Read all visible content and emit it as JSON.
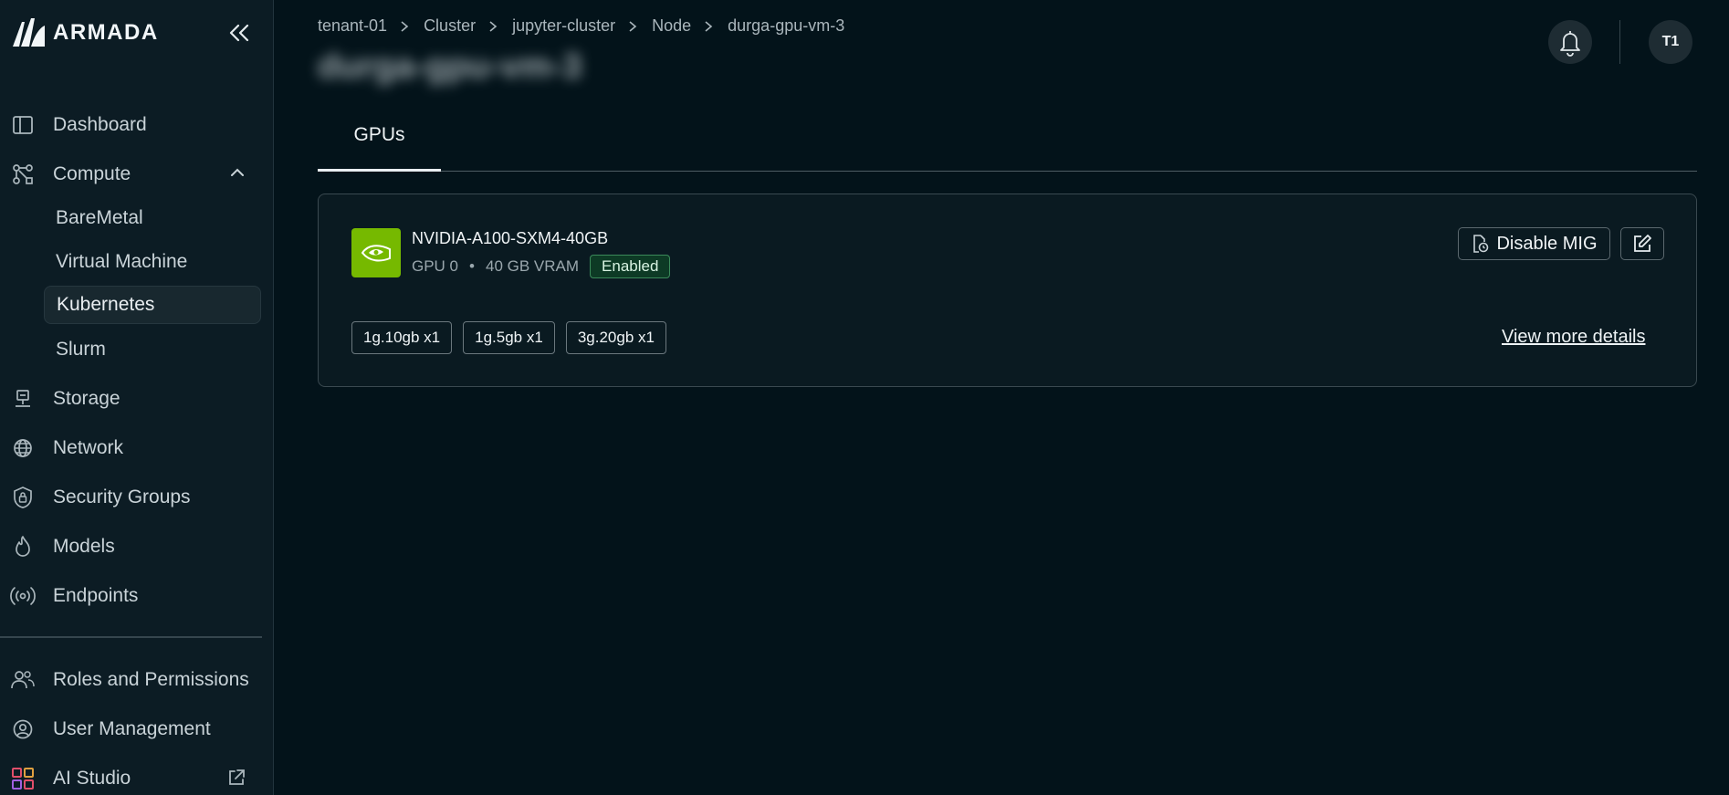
{
  "brand": {
    "name": "ARMADA"
  },
  "sidebar": {
    "items": [
      {
        "label": "Dashboard",
        "icon": "panel-icon"
      },
      {
        "label": "Compute",
        "icon": "nodes-icon"
      },
      {
        "label": "Storage",
        "icon": "storage-icon"
      },
      {
        "label": "Network",
        "icon": "globe-icon"
      },
      {
        "label": "Security Groups",
        "icon": "shield-lock-icon"
      },
      {
        "label": "Models",
        "icon": "flame-icon"
      },
      {
        "label": "Endpoints",
        "icon": "broadcast-icon"
      },
      {
        "label": "Roles and Permissions",
        "icon": "users-icon"
      },
      {
        "label": "User Management",
        "icon": "user-circle-icon"
      },
      {
        "label": "AI Studio",
        "icon": "grid-icon"
      }
    ],
    "compute_sub": [
      "BareMetal",
      "Virtual Machine",
      "Kubernetes",
      "Slurm"
    ],
    "active_sub": "Kubernetes"
  },
  "breadcrumb": [
    "tenant-01",
    "Cluster",
    "jupyter-cluster",
    "Node",
    "durga-gpu-vm-3"
  ],
  "page": {
    "title": "durga-gpu-vm-3"
  },
  "header": {
    "avatar_initials": "T1"
  },
  "tabs": [
    {
      "label": "GPUs",
      "active": true
    }
  ],
  "gpu": {
    "name": "NVIDIA-A100-SXM4-40GB",
    "index": "GPU 0",
    "dot": "•",
    "vram": "40 GB VRAM",
    "status": "Enabled",
    "disable_label": "Disable MIG",
    "profiles": [
      "1g.10gb x1",
      "1g.5gb x1",
      "3g.20gb x1"
    ],
    "view_more": "View more details"
  },
  "colors": {
    "accent_green": "#76b900",
    "enabled_bg": "#0d3a25",
    "background": "#03131a"
  }
}
